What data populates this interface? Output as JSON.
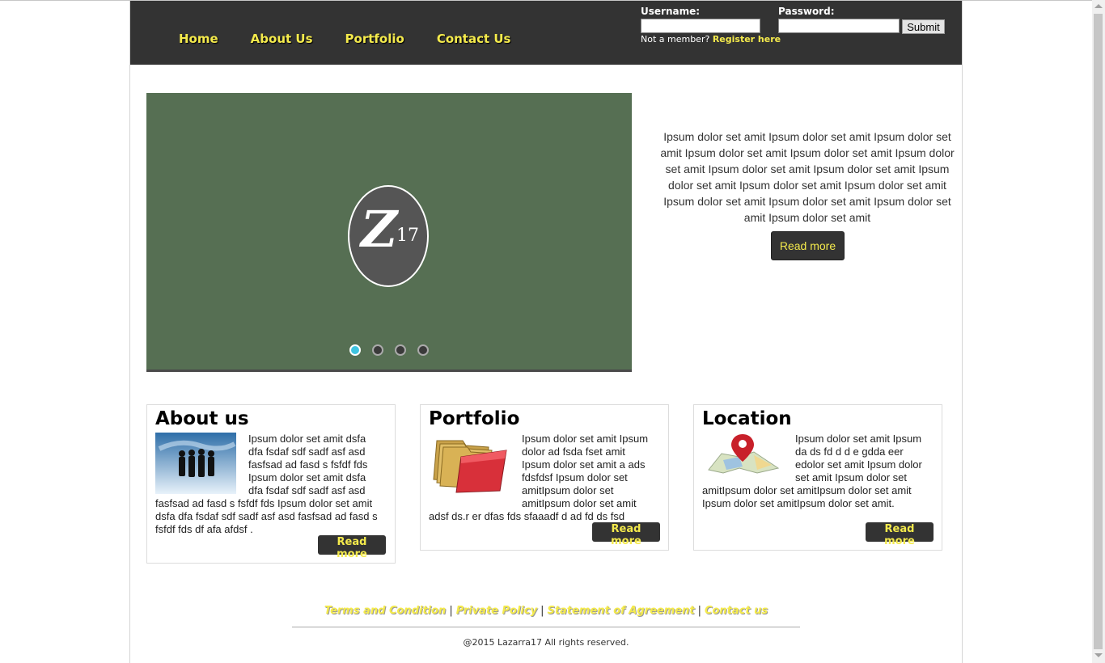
{
  "nav": {
    "items": [
      "Home",
      "About Us",
      "Portfolio",
      "Contact Us"
    ]
  },
  "login": {
    "username_label": "Username:",
    "password_label": "Password:",
    "submit_label": "Submit",
    "not_member_text": "Not a member?",
    "register_link": "Register here"
  },
  "slider": {
    "logo_letter": "Z",
    "logo_number": "17",
    "slide_count": 4,
    "active_slide": 1
  },
  "intro": {
    "text": "Ipsum dolor set amit Ipsum dolor set amit Ipsum dolor set amit Ipsum dolor set amit Ipsum dolor set amit Ipsum dolor set amit Ipsum dolor set amit Ipsum dolor set amit Ipsum dolor set amit Ipsum dolor set amit Ipsum dolor set amit Ipsum dolor set amit Ipsum dolor set amit Ipsum dolor set amit Ipsum dolor set amit",
    "button_label": "Read more"
  },
  "cards": [
    {
      "title": "About us",
      "text": "Ipsum dolor set amit dsfa dfa fsdaf sdf sadf asf asd fasfsad ad fasd s fsfdf fds Ipsum dolor set amit dsfa dfa fsdaf sdf sadf asf asd fasfsad ad fasd s fsfdf fds Ipsum dolor set amit dsfa dfa fsdaf sdf sadf asf asd fasfsad ad fasd s fsfdf fds df afa afdsf .",
      "button_label": "Read more"
    },
    {
      "title": "Portfolio",
      "text": "Ipsum dolor set amit Ipsum dolor ad fsda fset amit Ipsum dolor set amit a ads fdsfdsf Ipsum dolor set amitIpsum dolor set amitIpsum dolor set amit adsf ds.r er dfas fds sfaaadf d ad fd ds fsd",
      "button_label": "Read more"
    },
    {
      "title": "Location",
      "text": "Ipsum dolor set amit Ipsum da ds fd d d e gdda eer edolor set amit Ipsum dolor set amit Ipsum dolor set amitIpsum dolor set amitIpsum dolor set amit Ipsum dolor set amitIpsum dolor set amit.",
      "button_label": "Read more"
    }
  ],
  "footer": {
    "links": [
      "Terms and Condition",
      "Private Policy",
      "Statement of Agreement",
      "Contact us"
    ],
    "separator": "|",
    "copyright": "@2015 Lazarra17 All rights reserved."
  },
  "colors": {
    "header_bg": "#333333",
    "accent_yellow": "#f4ea4c",
    "slider_bg": "#566f53",
    "active_dot": "#3fc4e0"
  }
}
